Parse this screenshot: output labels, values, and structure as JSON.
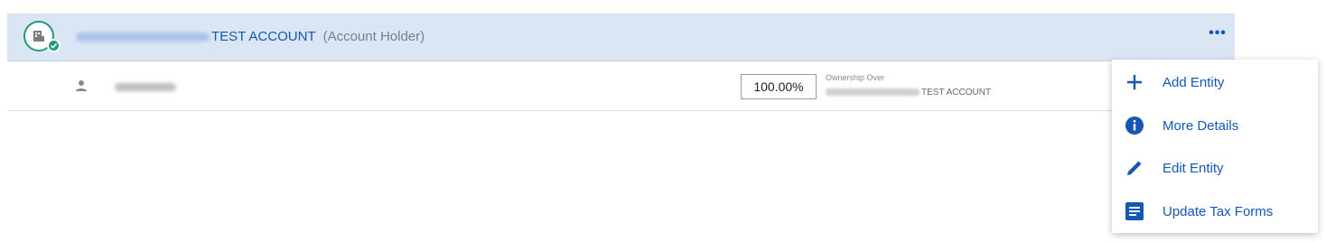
{
  "account": {
    "name_suffix": "TEST ACCOUNT",
    "role": "(Account Holder)",
    "more_label": "•••"
  },
  "owner": {
    "ownership_percent": "100.00%",
    "ownership_label": "Ownership Over",
    "ownership_target_suffix": "TEST ACCOUNT"
  },
  "menu": {
    "items": [
      {
        "label": "Add Entity",
        "icon": "plus-icon"
      },
      {
        "label": "More Details",
        "icon": "info-icon"
      },
      {
        "label": "Edit Entity",
        "icon": "pencil-icon"
      },
      {
        "label": "Update Tax Forms",
        "icon": "document-icon"
      }
    ]
  },
  "colors": {
    "accent": "#1457b4",
    "header_bg": "#dbe6f5",
    "success": "#1f9b78"
  }
}
